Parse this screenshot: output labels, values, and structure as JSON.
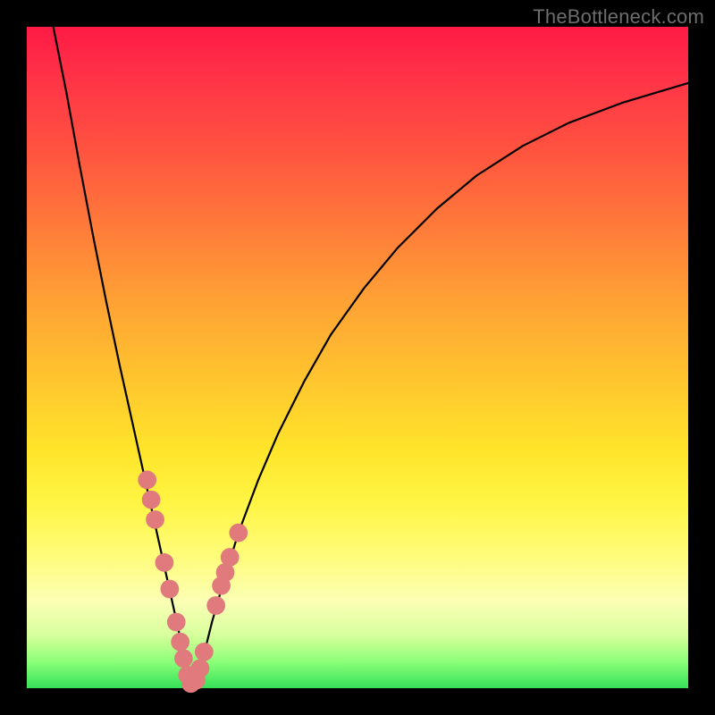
{
  "watermark": "TheBottleneck.com",
  "colors": {
    "frame": "#000000",
    "curve_stroke": "#000000",
    "marker_fill": "#e07a7c",
    "gradient_top": "#ff1a45",
    "gradient_bottom": "#35e05a"
  },
  "chart_data": {
    "type": "line",
    "title": "",
    "xlabel": "",
    "ylabel": "",
    "xlim": [
      0,
      100
    ],
    "ylim": [
      0,
      100
    ],
    "grid": false,
    "series": [
      {
        "name": "left-branch",
        "x": [
          4,
          6,
          8,
          10,
          12,
          14,
          16,
          18,
          19,
          20,
          21,
          22,
          23,
          24,
          24.5
        ],
        "y": [
          100,
          90,
          79,
          68.5,
          58.5,
          49,
          40,
          31,
          26.5,
          22,
          17.5,
          13,
          8.5,
          4,
          1.5
        ]
      },
      {
        "name": "right-branch",
        "x": [
          25,
          26,
          27,
          28,
          30,
          32,
          35,
          38,
          42,
          46,
          51,
          56,
          62,
          68,
          75,
          82,
          90,
          100
        ],
        "y": [
          0,
          2.5,
          6,
          10,
          17,
          23.5,
          31.5,
          38.5,
          46.5,
          53.5,
          60.5,
          66.5,
          72.5,
          77.5,
          82,
          85.5,
          88.5,
          91.5
        ]
      }
    ],
    "markers": {
      "name": "highlighted-points",
      "points": [
        {
          "x": 18.2,
          "y": 31.5
        },
        {
          "x": 18.8,
          "y": 28.5
        },
        {
          "x": 19.4,
          "y": 25.5
        },
        {
          "x": 20.8,
          "y": 19.0
        },
        {
          "x": 21.6,
          "y": 15.0
        },
        {
          "x": 22.6,
          "y": 10.0
        },
        {
          "x": 23.2,
          "y": 7.0
        },
        {
          "x": 23.7,
          "y": 4.5
        },
        {
          "x": 24.3,
          "y": 2.0
        },
        {
          "x": 24.8,
          "y": 0.7
        },
        {
          "x": 25.6,
          "y": 1.2
        },
        {
          "x": 26.2,
          "y": 3.0
        },
        {
          "x": 26.8,
          "y": 5.5
        },
        {
          "x": 28.6,
          "y": 12.5
        },
        {
          "x": 29.4,
          "y": 15.5
        },
        {
          "x": 30.0,
          "y": 17.5
        },
        {
          "x": 30.7,
          "y": 19.8
        },
        {
          "x": 32.0,
          "y": 23.5
        }
      ],
      "radius_value_units": 1.4
    }
  }
}
